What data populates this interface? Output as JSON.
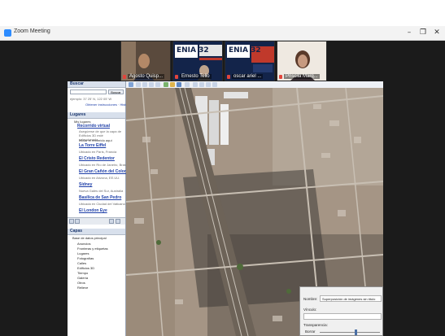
{
  "window": {
    "title": "Zoom Meeting",
    "minimize_glyph": "–",
    "restore_glyph": "❐",
    "close_glyph": "✕",
    "accent": "#2d8cff"
  },
  "participants": [
    {
      "name": "Agosto Quisp..."
    },
    {
      "name": "Ernesto Tello"
    },
    {
      "name": "oscar ariel ..."
    },
    {
      "name": "Priscila Marq..."
    }
  ],
  "slides": [
    {
      "logo": "ENIA 32",
      "text": "Encuentro Nacional de Investigadores"
    },
    {
      "logo": "ENIA 32",
      "text": "Encuentro Nacional de Investigadores"
    }
  ],
  "google_earth": {
    "search_header": "Buscar",
    "search_button": "Buscar",
    "search_hint": "ejemplo: 37 25' N, 122 05' W",
    "search_links": "Obtener instrucciones · Historial",
    "places_header": "Lugares",
    "places_root": "Mis lugares",
    "tour_title": "Recorrido virtual",
    "tour_desc": "Asegúrese de que la capa de Edificios 3D esté seleccionada",
    "tour_play": "Iniciar el recorrido aquí",
    "places": [
      {
        "title": "La Torre Eiffel",
        "subtitle": "Ubicado en París, Francia"
      },
      {
        "title": "El Cristo Redentor",
        "subtitle": "Ubicado en Río de Janeiro, Brasil"
      },
      {
        "title": "El Gran Cañón del Colorado",
        "subtitle": "Ubicado en Arizona, EE.UU."
      },
      {
        "title": "Sídney",
        "subtitle": "Nueva Gales del Sur, Australia"
      },
      {
        "title": "Basílica de San Pedro",
        "subtitle": "Ubicada en Ciudad del Vaticano"
      },
      {
        "title": "El London Eye",
        "subtitle": ""
      }
    ],
    "layers_header": "Capas",
    "layers_root": "Base de datos principal",
    "layers": [
      "Anuncios",
      "Fronteras y etiquetas",
      "Lugares",
      "Fotografías",
      "Calles",
      "Edificios 3D",
      "Tiempo",
      "Galería",
      "Otros",
      "Relieve"
    ],
    "dialog": {
      "name_label": "Nombre:",
      "name_value": "Superposición de imágenes sin título",
      "link_label": "Vínculo:",
      "transparency_label": "Transparencia:",
      "transparency_left": "Borrar",
      "transparency_value": 0.6
    }
  }
}
